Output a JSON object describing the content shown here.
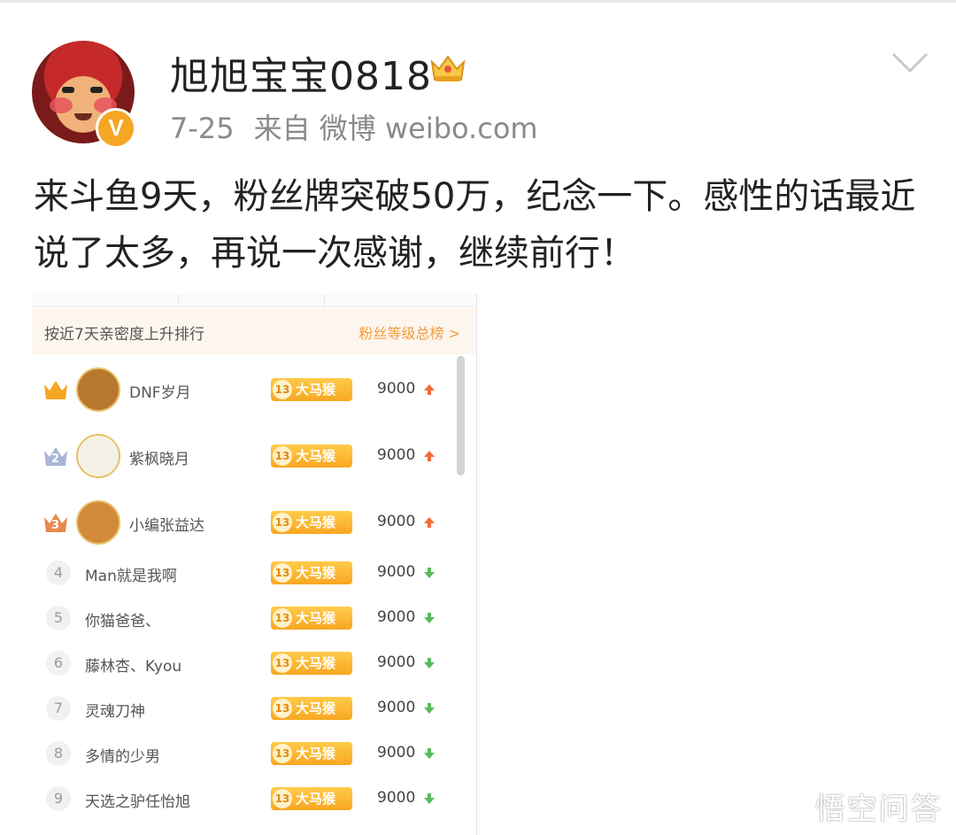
{
  "post": {
    "username": "旭旭宝宝0818",
    "date": "7-25",
    "source": "来自 微博 weibo.com",
    "verified_mark": "V",
    "text": "来斗鱼9天，粉丝牌突破50万，纪念一下。感性的话最近说了太多，再说一次感谢，继续前行！"
  },
  "screenshot": {
    "header_left": "按近7天亲密度上升排行",
    "header_right": "粉丝等级总榜 >",
    "badge_level": "13",
    "badge_name": "大马猴",
    "rows": [
      {
        "rank": "1",
        "name": "DNF岁月",
        "score": "9000",
        "trend": "up"
      },
      {
        "rank": "2",
        "name": "紫枫晓月",
        "score": "9000",
        "trend": "up"
      },
      {
        "rank": "3",
        "name": "小编张益达",
        "score": "9000",
        "trend": "up"
      },
      {
        "rank": "4",
        "name": "Man就是我啊",
        "score": "9000",
        "trend": "down"
      },
      {
        "rank": "5",
        "name": "你猫爸爸、",
        "score": "9000",
        "trend": "down"
      },
      {
        "rank": "6",
        "name": "藤林杏、Kyou",
        "score": "9000",
        "trend": "down"
      },
      {
        "rank": "7",
        "name": "灵魂刀神",
        "score": "9000",
        "trend": "down"
      },
      {
        "rank": "8",
        "name": "多情的少男",
        "score": "9000",
        "trend": "down"
      },
      {
        "rank": "9",
        "name": "天选之驴任怡旭",
        "score": "9000",
        "trend": "down"
      }
    ]
  },
  "watermark": "悟空问答",
  "colors": {
    "up": "#f26b3a",
    "down": "#5bb85b",
    "gold": "#f5a623",
    "silver": "#aab4d6",
    "bronze": "#e8884f"
  }
}
